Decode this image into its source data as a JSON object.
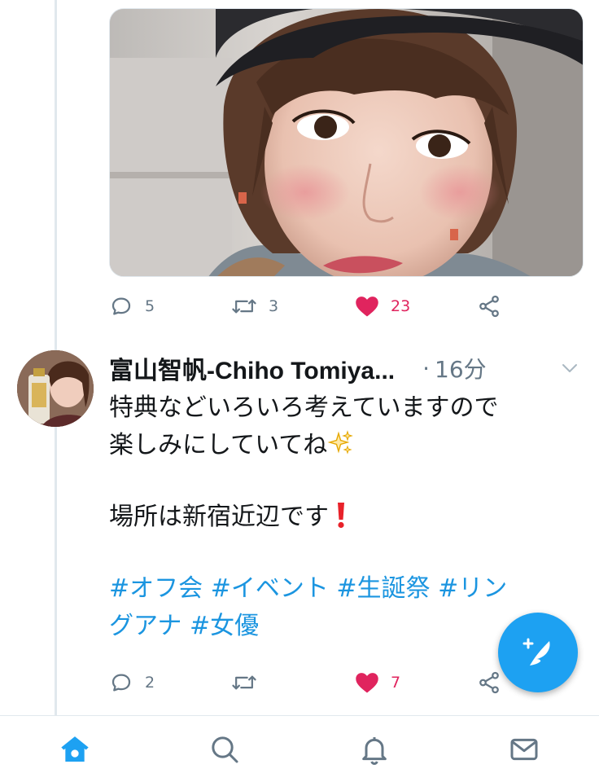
{
  "media_tweet": {
    "actions": {
      "reply_count": "5",
      "retweet_count": "3",
      "like_count": "23"
    }
  },
  "tweet": {
    "display_name": "富山智帆-Chiho Tomiya...",
    "separator": "·",
    "time": "16分",
    "text_lines": [
      "特典などいろいろ考えていますので",
      "楽しみにしていてね",
      "場所は新宿近辺です"
    ],
    "hashtags_line1": [
      "#オフ会",
      "#イベント",
      "#生誕祭",
      "#リン"
    ],
    "hashtags_line2": [
      "グアナ",
      "#女優"
    ],
    "actions": {
      "reply_count": "2",
      "retweet_count": "",
      "like_count": "7"
    }
  },
  "colors": {
    "accent": "#1da1f2",
    "hashtag": "#1b95e0",
    "like": "#e0245e",
    "muted": "#657786"
  },
  "icons": {
    "reply": "speech-bubble-icon",
    "retweet": "retweet-arrows-icon",
    "like": "heart-icon",
    "share": "share-nodes-icon",
    "compose": "feather-plus-icon",
    "home": "home-icon",
    "search": "search-icon",
    "notifications": "bell-icon",
    "messages": "envelope-icon"
  }
}
